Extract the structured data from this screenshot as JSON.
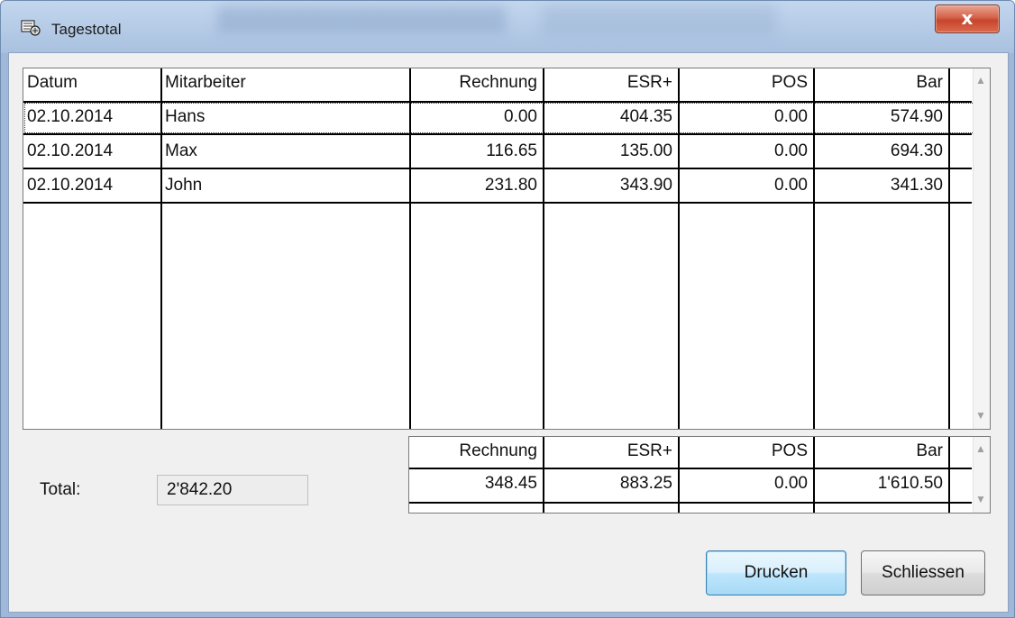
{
  "window": {
    "title": "Tagestotal",
    "close_symbol": "x"
  },
  "table": {
    "columns": [
      "Datum",
      "Mitarbeiter",
      "Rechnung",
      "ESR+",
      "POS",
      "Bar"
    ],
    "rows": [
      [
        "02.10.2014",
        "Hans",
        "0.00",
        "404.35",
        "0.00",
        "574.90"
      ],
      [
        "02.10.2014",
        "Max",
        "116.65",
        "135.00",
        "0.00",
        "694.30"
      ],
      [
        "02.10.2014",
        "John",
        "231.80",
        "343.90",
        "0.00",
        "341.30"
      ]
    ]
  },
  "totals": {
    "label": "Total:",
    "sum": "2'842.20",
    "columns": [
      "Rechnung",
      "ESR+",
      "POS",
      "Bar"
    ],
    "values": [
      "348.45",
      "883.25",
      "0.00",
      "1'610.50"
    ]
  },
  "buttons": {
    "print": "Drucken",
    "close": "Schliessen"
  },
  "icons": {
    "app": "app-icon",
    "scroll_up": "scroll-up-arrow-icon",
    "scroll_down": "scroll-down-arrow-icon"
  }
}
